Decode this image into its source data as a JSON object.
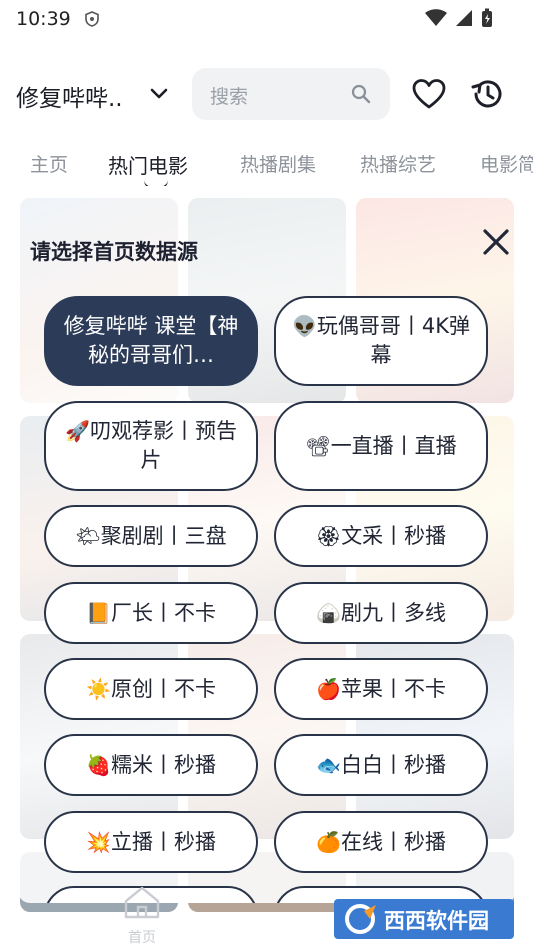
{
  "status_bar": {
    "time": "10:39"
  },
  "header": {
    "source_title": "修复哔哔..",
    "search_placeholder": "搜索"
  },
  "tabs": [
    {
      "label": "主页",
      "active": false
    },
    {
      "label": "热门电影",
      "active": true
    },
    {
      "label": "热播剧集",
      "active": false
    },
    {
      "label": "热播综艺",
      "active": false
    },
    {
      "label": "电影简",
      "active": false
    }
  ],
  "dialog": {
    "title": "请选择首页数据源",
    "sources": [
      {
        "icon": "",
        "label": "修复哔哔 课堂【神秘的哥哥们…",
        "selected": true
      },
      {
        "icon": "👽",
        "label": "玩偶哥哥丨4K弹幕",
        "selected": false
      },
      {
        "icon": "🚀",
        "label": "叨观荐影丨预告片",
        "selected": false
      },
      {
        "icon": "📽",
        "label": "一直播丨直播",
        "selected": false
      },
      {
        "icon": "🌤",
        "label": "聚剧剧丨三盘",
        "selected": false
      },
      {
        "icon": "🏵",
        "label": "文采丨秒播",
        "selected": false
      },
      {
        "icon": "📙",
        "label": "厂长丨不卡",
        "selected": false
      },
      {
        "icon": "🍙",
        "label": "剧九丨多线",
        "selected": false
      },
      {
        "icon": "☀️",
        "label": "原创丨不卡",
        "selected": false
      },
      {
        "icon": "🍎",
        "label": "苹果丨不卡",
        "selected": false
      },
      {
        "icon": "🍓",
        "label": "糯米丨秒播",
        "selected": false
      },
      {
        "icon": "🐟",
        "label": "白白丨秒播",
        "selected": false
      },
      {
        "icon": "💥",
        "label": "立播丨秒播",
        "selected": false
      },
      {
        "icon": "🍊",
        "label": "在线丨秒播",
        "selected": false
      }
    ]
  },
  "bottom_nav": {
    "home_label": "首页"
  },
  "watermark": {
    "text": "西西软件园"
  },
  "colors": {
    "selected_chip": "#2c3c58",
    "chip_border": "#2a3448"
  }
}
